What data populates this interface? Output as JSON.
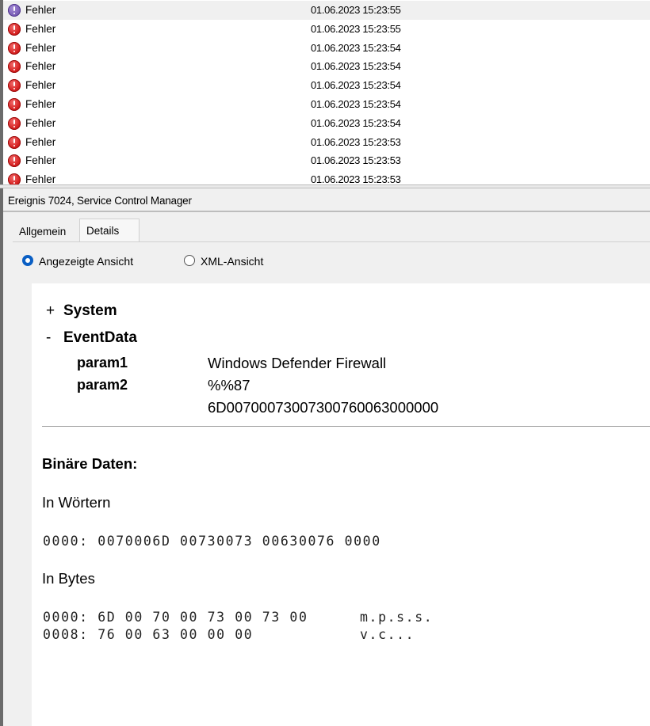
{
  "events": [
    {
      "level": "Fehler",
      "date": "01.06.2023 15:23:55",
      "selected": true
    },
    {
      "level": "Fehler",
      "date": "01.06.2023 15:23:55"
    },
    {
      "level": "Fehler",
      "date": "01.06.2023 15:23:54"
    },
    {
      "level": "Fehler",
      "date": "01.06.2023 15:23:54"
    },
    {
      "level": "Fehler",
      "date": "01.06.2023 15:23:54"
    },
    {
      "level": "Fehler",
      "date": "01.06.2023 15:23:54"
    },
    {
      "level": "Fehler",
      "date": "01.06.2023 15:23:54"
    },
    {
      "level": "Fehler",
      "date": "01.06.2023 15:23:53"
    },
    {
      "level": "Fehler",
      "date": "01.06.2023 15:23:53"
    },
    {
      "level": "Fehler",
      "date": "01.06.2023 15:23:53"
    }
  ],
  "detail": {
    "title": "Ereignis 7024, Service Control Manager",
    "tabs": {
      "general": "Allgemein",
      "details": "Details"
    },
    "view": {
      "displayed": "Angezeigte Ansicht",
      "xml": "XML-Ansicht",
      "selected": "displayed"
    },
    "tree": {
      "system_sign": "+",
      "system": "System",
      "eventdata_sign": "-",
      "eventdata": "EventData",
      "param1_name": "param1",
      "param1_value": "Windows Defender Firewall",
      "param2_name": "param2",
      "param2_value": "%%87",
      "param2_extra": "6D00700073007300760063000000"
    },
    "binary": {
      "heading": "Binäre Daten:",
      "words_label": "In Wörtern",
      "words": "0000: 0070006D 00730073 00630076 0000",
      "bytes_label": "In Bytes",
      "bytes_rows": [
        {
          "hex": "0000: 6D 00 70 00 73 00 73 00",
          "ascii": "m.p.s.s."
        },
        {
          "hex": "0008: 76 00 63 00 00 00",
          "ascii": "v.c..."
        }
      ]
    }
  },
  "colors": {
    "error_icon": "#d62020",
    "selected_icon": "#7b5fb8",
    "radio_accent": "#0a5fc4",
    "panel_bg": "#f0f0f0"
  }
}
